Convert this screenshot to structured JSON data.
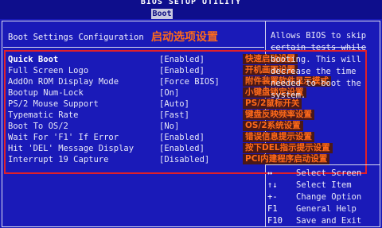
{
  "header": {
    "utility_title": "BIOS SETUP UTILITY",
    "active_tab": "Boot"
  },
  "section": {
    "title": "Boot Settings Configuration",
    "title_cn": "启动选项设置"
  },
  "settings": [
    {
      "label": "Quick Boot",
      "value": "[Enabled]",
      "note": "快速启动设置"
    },
    {
      "label": "Full Screen Logo",
      "value": "[Enabled]",
      "note": "开机画面设置"
    },
    {
      "label": "AddOn ROM Display Mode",
      "value": "[Force BIOS]",
      "note": "附件装置软件显示模式"
    },
    {
      "label": "Bootup Num-Lock",
      "value": "[On]",
      "note": "小键盘锁定设置"
    },
    {
      "label": "PS/2 Mouse Support",
      "value": "[Auto]",
      "note": "PS/2鼠标开关"
    },
    {
      "label": "Typematic Rate",
      "value": "[Fast]",
      "note": "键盘反映频率设置"
    },
    {
      "label": "Boot To OS/2",
      "value": "[No]",
      "note": "OS/2系统设置"
    },
    {
      "label": "Wait For 'F1' If Error",
      "value": "[Enabled]",
      "note": "错误信息提示设置"
    },
    {
      "label": "Hit 'DEL' Message Display",
      "value": "[Enabled]",
      "note": "按下DEL指示提示设置"
    },
    {
      "label": "Interrupt 19 Capture",
      "value": "[Disabled]",
      "note": "PCI内建程序启动设置"
    }
  ],
  "help": {
    "lines": [
      "Allows BIOS to skip",
      "certain tests while",
      "booting. This will",
      "decrease the time",
      "needed to boot the",
      "system."
    ]
  },
  "keys": [
    {
      "key": "↔",
      "desc": "Select Screen"
    },
    {
      "key": "↑↓",
      "desc": "Select Item"
    },
    {
      "key": "+-",
      "desc": "Change Option"
    },
    {
      "key": "F1",
      "desc": "General Help"
    },
    {
      "key": "F10",
      "desc": "Save and Exit"
    }
  ],
  "colors": {
    "background": "#1a1ab8",
    "annotation": "#ff6a1a",
    "highlight_box": "#e0202a"
  }
}
